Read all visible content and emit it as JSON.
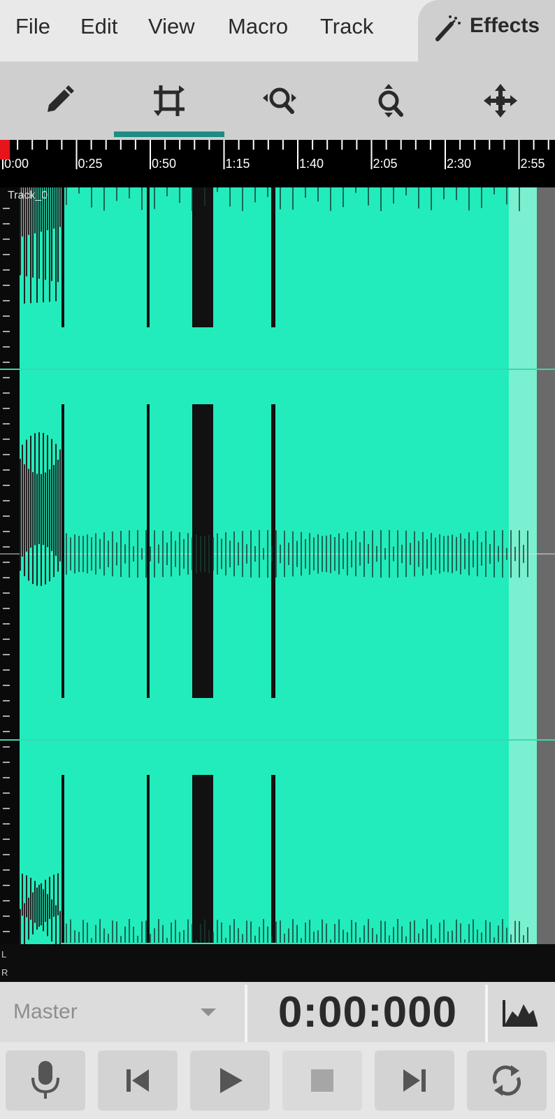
{
  "menu": {
    "items": [
      "File",
      "Edit",
      "View",
      "Macro",
      "Track"
    ],
    "effects_label": "Effects"
  },
  "toolbar": {
    "tools": [
      "pencil-icon",
      "crop-icon",
      "zoom-horizontal-icon",
      "zoom-vertical-icon",
      "move-icon"
    ],
    "active_tool": "crop-icon",
    "accent_color": "#1e8c84"
  },
  "timeline": {
    "labels": [
      "0:00",
      "0:25",
      "0:50",
      "1:15",
      "1:40",
      "2:05",
      "2:30",
      "2:55"
    ],
    "playhead_color": "#e8141c"
  },
  "track": {
    "name": "Track_0",
    "wave_color": "#22ecbc",
    "selection_color": "#7af0d0"
  },
  "channels": {
    "left": "L",
    "right": "R"
  },
  "info": {
    "bus": "Master",
    "time": "0:00:000"
  },
  "transport": {
    "buttons": [
      "record-icon",
      "skip-back-icon",
      "play-icon",
      "stop-icon",
      "skip-forward-icon",
      "loop-icon"
    ]
  }
}
